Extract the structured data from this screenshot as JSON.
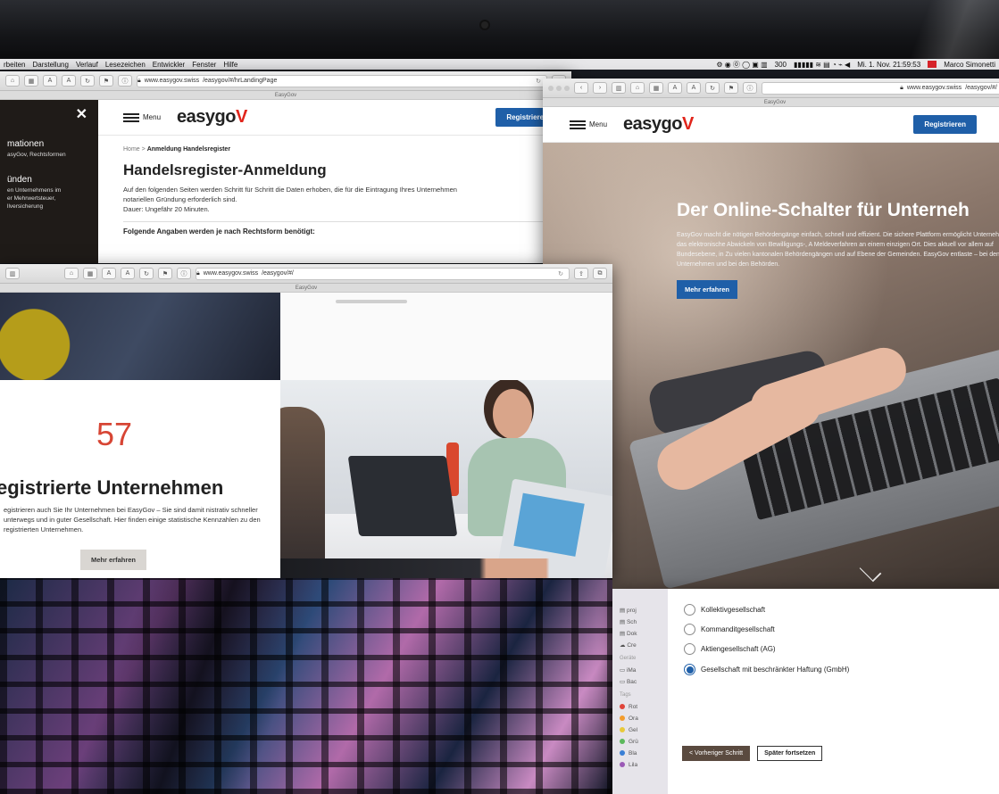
{
  "menubar": {
    "items": [
      "rbeiten",
      "Darstellung",
      "Verlauf",
      "Lesezeichen",
      "Entwickler",
      "Fenster",
      "Hilfe"
    ],
    "status_zoom": "300",
    "clock": "Mi. 1. Nov.  21:59:53",
    "user": "Marco Simonetti"
  },
  "windowA": {
    "url_domain": "www.easygov.swiss",
    "url_path": "/easygov/#/hrLandingPage",
    "tab_title": "EasyGov",
    "sidenav": {
      "close_glyph": "✕",
      "group1_title": "mationen",
      "group1_text": "asyGov, Rechtsformen",
      "group2_title": "ünden",
      "group2_text_1": "en Unternehmens im",
      "group2_text_2": "er Mehrwertsteuer,",
      "group2_text_3": "llversicherung"
    },
    "menu_label": "Menu",
    "logo_text": "easygo",
    "logo_accent": "V",
    "register_label": "Registrieren",
    "breadcrumb_home": "Home",
    "breadcrumb_sep": ">",
    "breadcrumb_current": "Anmeldung Handelsregister",
    "title": "Handelsregister-Anmeldung",
    "intro_line1": "Auf den folgenden Seiten werden Schritt für Schritt die Daten erhoben, die für die Eintragung Ihres Unternehmen",
    "intro_line2": "notariellen Gründung erforderlich sind.",
    "intro_line3": "Dauer: Ungefähr 20 Minuten.",
    "subheading": "Folgende Angaben werden je nach Rechtsform benötigt:"
  },
  "windowB": {
    "url_domain": "www.easygov.swiss",
    "url_path": "/easygov/#/",
    "tab_title": "EasyGov",
    "menu_label": "Menu",
    "logo_text": "easygo",
    "logo_accent": "V",
    "register_label": "Registrieren",
    "hero_title": "Der Online-Schalter für Unterneh",
    "hero_text": "EasyGov macht die nötigen Behördengänge einfach, schnell und effizient. Die sichere Plattform ermöglicht Unternehmen das elektronische Abwickeln von Bewilligungs-, A Meldeverfahren an einem einzigen Ort. Dies aktuell vor allem auf Bundesebene, in Zu vielen kantonalen Behördengängen und auf Ebene der Gemeinden. EasyGov entlaste – bei den Unternehmen und bei den Behörden.",
    "hero_button": "Mehr erfahren"
  },
  "windowC": {
    "url_domain": "www.easygov.swiss",
    "url_path": "/easygov/#/",
    "tab_title": "EasyGov",
    "count": "57",
    "title": "egistrierte Unternehmen",
    "text": "egistrieren auch Sie Ihr Unternehmen bei EasyGov – Sie sind damit nistrativ schneller unterwegs und in guter Gesellschaft. Hier finden einige statistische Kennzahlen zu den registrierten Unternehmen.",
    "button": "Mehr erfahren"
  },
  "windowD": {
    "finder": {
      "items": [
        "proj",
        "Sch",
        "Dok",
        "Cre"
      ],
      "devices_label": "Geräte",
      "devices": [
        "iMa",
        "Bac"
      ],
      "tags_label": "Tags",
      "tags": [
        {
          "label": "Rot",
          "color": "#e0443a"
        },
        {
          "label": "Ora",
          "color": "#f39c2d"
        },
        {
          "label": "Gel",
          "color": "#e8c93a"
        },
        {
          "label": "Grü",
          "color": "#5cb85c"
        },
        {
          "label": "Bla",
          "color": "#3a7fd5"
        },
        {
          "label": "Lila",
          "color": "#9b59b6"
        }
      ]
    },
    "options": [
      {
        "label": "Kollektivgesellschaft",
        "selected": false
      },
      {
        "label": "Kommanditgesellschaft",
        "selected": false
      },
      {
        "label": "Aktiengesellschaft (AG)",
        "selected": false
      },
      {
        "label": "Gesellschaft mit beschränkter Haftung (GmbH)",
        "selected": true
      }
    ],
    "prev_label": "<  Vorheriger Schritt",
    "later_label": "Später fortsetzen"
  },
  "colors": {
    "brand_blue": "#1f5fa8",
    "accent_red": "#e1251b",
    "count_red": "#d74534"
  }
}
